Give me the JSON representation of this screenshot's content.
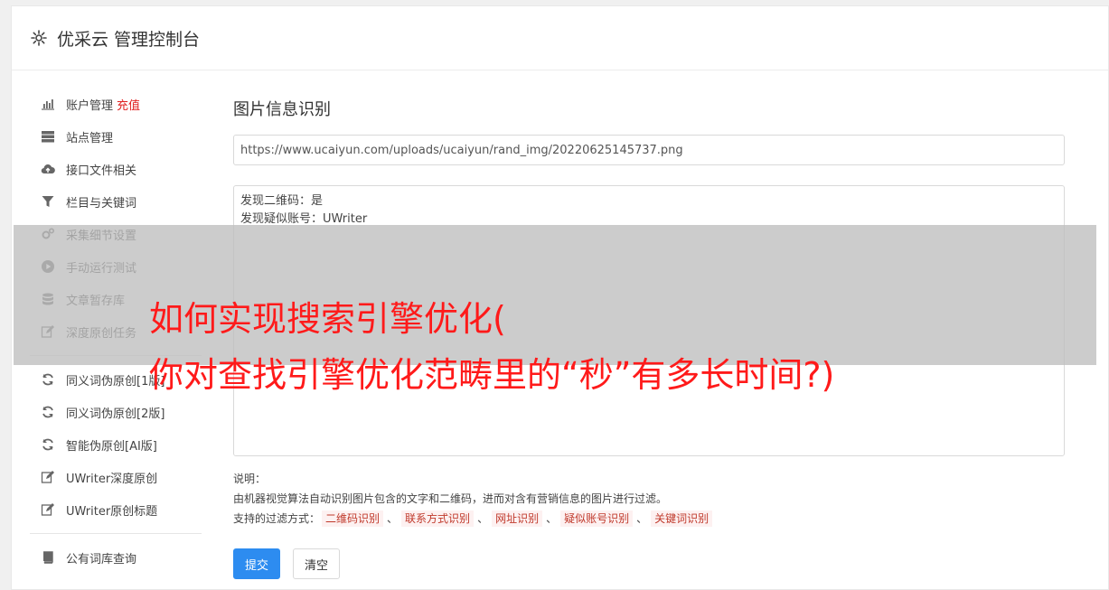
{
  "header": {
    "title": "优采云 管理控制台",
    "icon": "gear-icon"
  },
  "sidebar": {
    "groups": [
      [
        {
          "label": "账户管理",
          "extra": "充值",
          "icon": "bar-chart-icon"
        },
        {
          "label": "站点管理",
          "icon": "server-icon"
        },
        {
          "label": "接口文件相关",
          "icon": "cloud-upload-icon"
        },
        {
          "label": "栏目与关键词",
          "icon": "filter-icon"
        },
        {
          "label": "采集细节设置",
          "icon": "cogs-icon"
        },
        {
          "label": "手动运行测试",
          "icon": "play-circle-icon"
        },
        {
          "label": "文章暂存库",
          "icon": "database-icon"
        },
        {
          "label": "深度原创任务",
          "icon": "edit-icon"
        }
      ],
      [
        {
          "label": "同义词伪原创[1版]",
          "icon": "refresh-icon"
        },
        {
          "label": "同义词伪原创[2版]",
          "icon": "refresh-icon"
        },
        {
          "label": "智能伪原创[AI版]",
          "icon": "refresh-icon"
        },
        {
          "label": "UWriter深度原创",
          "icon": "edit-icon"
        },
        {
          "label": "UWriter原创标题",
          "icon": "edit-icon"
        }
      ],
      [
        {
          "label": "公有词库查询",
          "icon": "book-icon"
        }
      ]
    ]
  },
  "main": {
    "title": "图片信息识别",
    "url_value": "https://www.ucaiyun.com/uploads/ucaiyun/rand_img/20220625145737.png",
    "result_lines": [
      "发现二维码：是",
      "发现疑似账号：UWriter"
    ],
    "desc_label": "说明：",
    "desc_text": "由机器视觉算法自动识别图片包含的文字和二维码，进而对含有营销信息的图片进行过滤。",
    "filter_label": "支持的过滤方式：",
    "filters": [
      "二维码识别",
      "联系方式识别",
      "网址识别",
      "疑似账号识别",
      "关键词识别"
    ],
    "filter_sep": "、",
    "submit_label": "提交",
    "clear_label": "清空"
  },
  "overlay": {
    "line1": "如何实现搜索引擎优化(",
    "line2": "你对查找引擎优化范畴里的“秒”有多长时间?)"
  },
  "colors": {
    "primary": "#2d8cf0",
    "accent_red": "#e02020",
    "overlay_text": "#ff1a1a"
  }
}
